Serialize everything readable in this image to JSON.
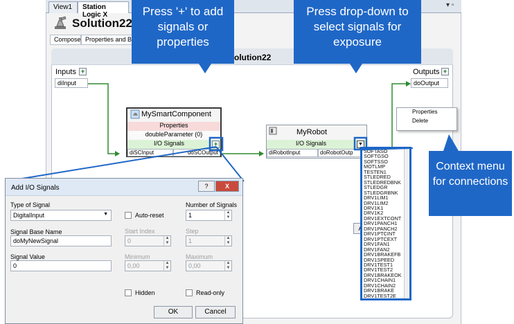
{
  "window": {
    "tabs": [
      "View1",
      "Station Logic"
    ],
    "tab_close": "X",
    "title": "Solution22",
    "subtabs": [
      "Compose",
      "Properties and Bindi"
    ],
    "window_controls": "▾ ▫"
  },
  "canvas": {
    "title": "Solution22",
    "inputs_label": "Inputs",
    "outputs_label": "Outputs",
    "input_port": "diInput",
    "output_port": "doOutput",
    "truncated_button": "Au"
  },
  "smart_component": {
    "name": "MySmartComponent",
    "properties": "Properties",
    "param": "doubleParameter (0)",
    "io_signals": "I/O Signals",
    "in_port": "diSCInput",
    "out_port": "doSCOutput"
  },
  "robot": {
    "name": "MyRobot",
    "io_signals": "I/O Signals",
    "in_port": "diRobotInput",
    "out_port": "doRobotOutp"
  },
  "callouts": {
    "add": "Press '+' to add signals or properties",
    "dropdown": "Press drop-down to select signals for exposure",
    "context": "Context menu for connections"
  },
  "context_menu": {
    "items": [
      "Properties",
      "Delete"
    ]
  },
  "signal_list": {
    "items": [
      "SOFTASO",
      "SOFTGSO",
      "SOFTSSO",
      "MOTLMP",
      "TESTEN1",
      "STLEDRED",
      "STLEDREDBNK",
      "STLEDGR",
      "STLEDGRBNK",
      "DRV1LIM1",
      "DRV1LIM2",
      "DRV1K1",
      "DRV1K2",
      "DRV1EXTCONT",
      "DRV1PANCH1",
      "DRV1PANCH2",
      "DRV1PTCINT",
      "DRV1PTCEXT",
      "DRV1FAN1",
      "DRV1FAN2",
      "DRV1BRAKEFB",
      "DRV1SPEED",
      "DRV1TEST1",
      "DRV1TEST2",
      "DRV1BRAKEOK",
      "DRV1CHAIN1",
      "DRV1CHAIN2",
      "DRV1BRAKE",
      "DRV1TEST2E"
    ]
  },
  "dialog": {
    "title": "Add I/O Signals",
    "help_glyph": "?",
    "close_glyph": "X",
    "type_label": "Type of Signal",
    "type_value": "DigitalInput",
    "autoreset_label": "Auto-reset",
    "num_label": "Number of Signals",
    "num_value": "1",
    "base_name_label": "Signal Base Name",
    "base_name_value": "doMyNewSignal",
    "start_index_label": "Start Index",
    "start_index_value": "0",
    "step_label": "Step",
    "step_value": "1",
    "signal_value_label": "Signal Value",
    "signal_value": "0",
    "minimum_label": "Minimum",
    "minimum_value": "0,00",
    "maximum_label": "Maximum",
    "maximum_value": "0,00",
    "hidden_label": "Hidden",
    "readonly_label": "Read-only",
    "ok_label": "OK",
    "cancel_label": "Cancel"
  },
  "colors": {
    "callout": "#1f67c7",
    "wire": "#2e8b2e",
    "properties_row": "#f8dada",
    "io_row": "#dcf2d6"
  }
}
